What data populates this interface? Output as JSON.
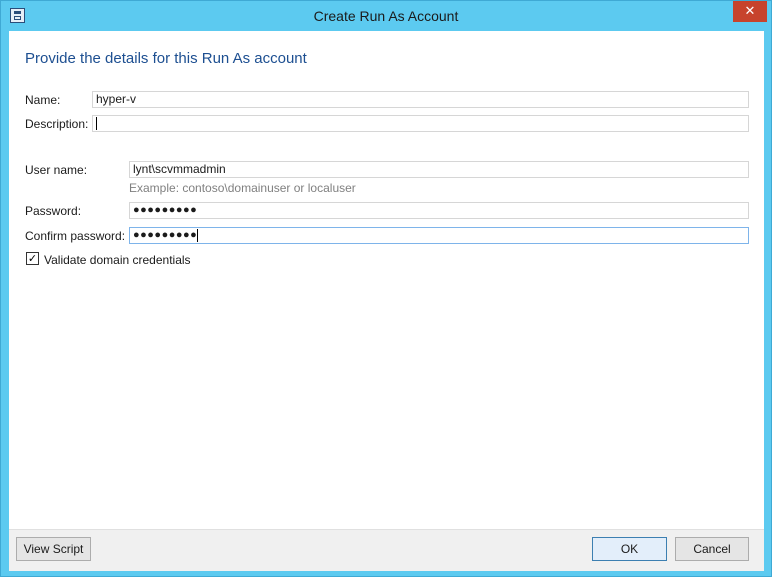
{
  "window": {
    "title": "Create Run As Account",
    "close_glyph": "✕",
    "icon": "run-as-account-icon"
  },
  "form": {
    "heading": "Provide the details for this Run As account",
    "name_label": "Name:",
    "name_value": "hyper-v",
    "description_label": "Description:",
    "description_value": "",
    "username_label": "User name:",
    "username_value": "lynt\\scvmmadmin",
    "username_hint": "Example: contoso\\domainuser or localuser",
    "password_label": "Password:",
    "password_value": "●●●●●●●●●",
    "confirm_label": "Confirm password:",
    "confirm_value": "●●●●●●●●●",
    "validate_label": "Validate domain credentials",
    "validate_checked": true
  },
  "footer": {
    "view_script": "View Script",
    "ok": "OK",
    "cancel": "Cancel"
  },
  "colors": {
    "frame": "#5ccaf0",
    "heading": "#1d4f91",
    "close": "#c7432c"
  }
}
